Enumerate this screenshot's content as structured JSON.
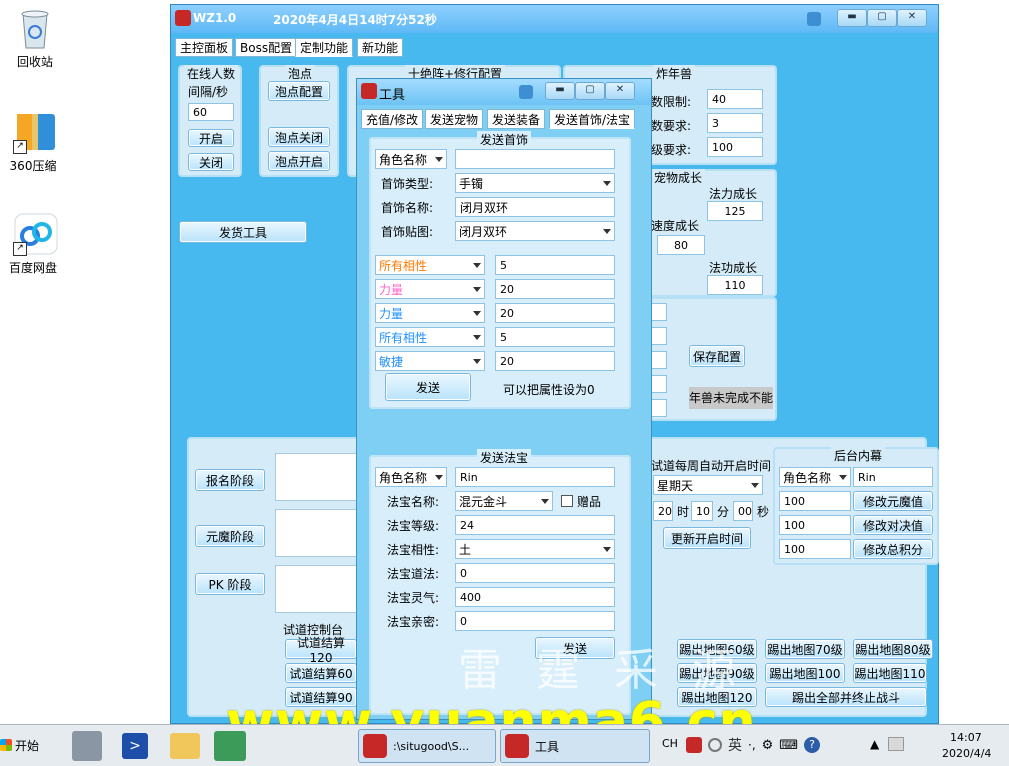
{
  "desktop": {
    "icons": [
      {
        "label": "回收站",
        "icon": "recycle-bin-icon"
      },
      {
        "label": "360压缩",
        "icon": "archive-icon"
      },
      {
        "label": "百度网盘",
        "icon": "cloud-drive-icon"
      }
    ]
  },
  "main": {
    "title": "WZ1.0",
    "datetime": "2020年4月4日14时7分52秒",
    "tabs": [
      "主控面板",
      "Boss配置",
      "定制功能",
      "新功能"
    ],
    "online": {
      "title": "在线人数",
      "interval_label": "间隔/秒",
      "interval_value": "60",
      "open": "开启",
      "close": "关闭"
    },
    "bubble": {
      "title": "泡点",
      "config": "泡点配置",
      "off": "泡点关闭",
      "on": "泡点开启"
    },
    "tower_title": "十绝阵+修行配置",
    "nian": {
      "title": "炸年兽",
      "label1": "数限制:",
      "value1": "40",
      "label2": "数要求:",
      "value2": "3",
      "label3": "级要求:",
      "value3": "100"
    },
    "growth": {
      "title": "宠物成长",
      "mana_label": "法力成长",
      "mana_value": "125",
      "speed_label": "速度成长",
      "speed_value": "80",
      "skill_label": "法功成长",
      "skill_value": "110"
    },
    "save_config": "保存配置",
    "nian_status": "年兽未完成不能",
    "send_tool": "发货工具",
    "stages": {
      "signup": "报名阶段",
      "yuanmo": "元魔阶段",
      "pk": "PK 阶段"
    },
    "trial": {
      "title": "试道控制台",
      "settle120": "试道结算120",
      "settle60": "试道结算60",
      "settle90": "试道结算90"
    },
    "schedule": {
      "title": "试道每周自动开启时间",
      "weekday": "星期天",
      "hour": "20",
      "hour_unit": "时",
      "minute": "10",
      "minute_unit": "分",
      "second": "00",
      "second_unit": "秒",
      "update": "更新开启时间"
    },
    "backend": {
      "title": "后台内幕",
      "role_label": "角色名称",
      "role_value": "Rin",
      "v1": "100",
      "b1": "修改元魔值",
      "v2": "100",
      "b2": "修改对决值",
      "v3": "100",
      "b3": "修改总积分"
    },
    "kick": {
      "b60": "踢出地图60级",
      "b70": "踢出地图70级",
      "b80": "踢出地图80级",
      "b90": "踢出地图90级",
      "b100": "踢出地图100",
      "b110": "踢出地图110",
      "b120": "踢出地图120",
      "all": "踢出全部并终止战斗"
    }
  },
  "tool": {
    "title": "工具",
    "tabs": [
      "充值/修改",
      "发送宠物",
      "发送装备",
      "发送首饰/法宝"
    ],
    "jewelry": {
      "title": "发送首饰",
      "role_label": "角色名称",
      "role_value": "",
      "type_label": "首饰类型:",
      "type_value": "手镯",
      "name_label": "首饰名称:",
      "name_value": "闭月双环",
      "img_label": "首饰贴图:",
      "img_value": "闭月双环",
      "attrs": [
        {
          "name": "所有相性",
          "value": "5",
          "color": "#ff7a00"
        },
        {
          "name": "力量",
          "value": "20",
          "color": "#ff66cc"
        },
        {
          "name": "力量",
          "value": "20",
          "color": "#1e90ff"
        },
        {
          "name": "所有相性",
          "value": "5",
          "color": "#1e90ff"
        },
        {
          "name": "敏捷",
          "value": "20",
          "color": "#1e90ff"
        }
      ],
      "send": "发送",
      "hint": "可以把属性设为0"
    },
    "treasure": {
      "title": "发送法宝",
      "role_label": "角色名称",
      "role_value": "Rin",
      "name_label": "法宝名称:",
      "name_value": "混元金斗",
      "gift_label": "赠品",
      "level_label": "法宝等级:",
      "level_value": "24",
      "element_label": "法宝相性:",
      "element_value": "土",
      "dao_label": "法宝道法:",
      "dao_value": "0",
      "spirit_label": "法宝灵气:",
      "spirit_value": "400",
      "affinity_label": "法宝亲密:",
      "affinity_value": "0",
      "send": "发送"
    }
  },
  "taskbar": {
    "start": "开始",
    "task1": ":\\situgood\\S...",
    "task2": "工具",
    "ime": "CH",
    "ime2": "英",
    "time": "14:07",
    "date": "2020/4/4"
  },
  "watermark": {
    "url": "www.yuanma6.cn",
    "text": "雷 霆 采 源"
  }
}
